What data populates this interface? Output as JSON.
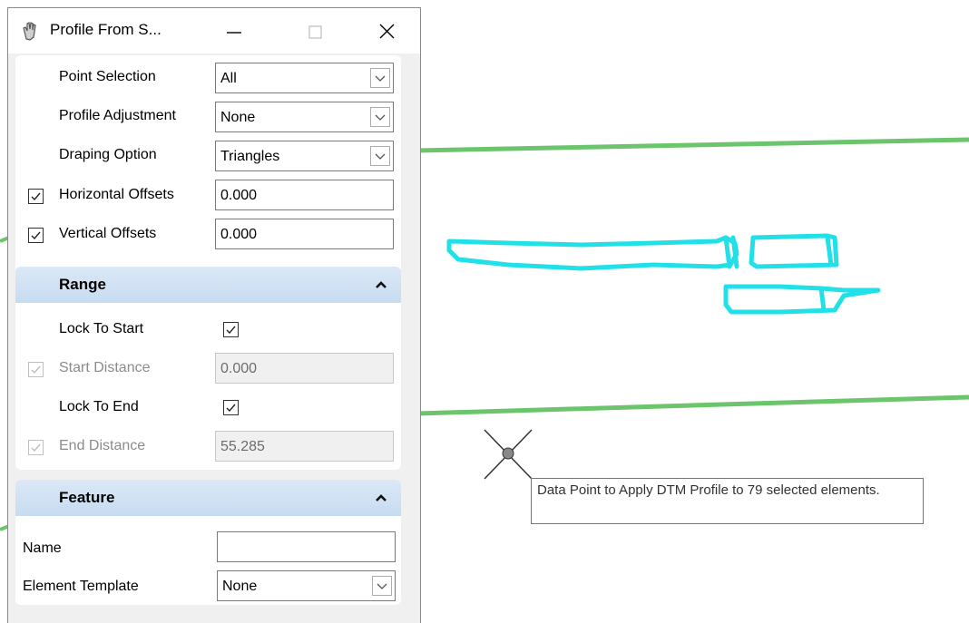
{
  "window": {
    "title": "Profile From S...",
    "minimize_icon": "minimize-icon",
    "maximize_icon": "maximize-icon",
    "close_icon": "close-icon",
    "app_icon": "hand-icon"
  },
  "settings": {
    "point_selection": {
      "label": "Point Selection",
      "value": "All"
    },
    "profile_adjustment": {
      "label": "Profile Adjustment",
      "value": "None"
    },
    "draping_option": {
      "label": "Draping Option",
      "value": "Triangles"
    },
    "horizontal_offsets": {
      "label": "Horizontal Offsets",
      "checked": true,
      "value": "0.000"
    },
    "vertical_offsets": {
      "label": "Vertical Offsets",
      "checked": true,
      "value": "0.000"
    }
  },
  "range": {
    "title": "Range",
    "lock_to_start": {
      "label": "Lock To Start",
      "checked": true
    },
    "start_distance": {
      "label": "Start Distance",
      "checked": true,
      "disabled": true,
      "value": "0.000"
    },
    "lock_to_end": {
      "label": "Lock To End",
      "checked": true
    },
    "end_distance": {
      "label": "End Distance",
      "checked": true,
      "disabled": true,
      "value": "55.285"
    }
  },
  "feature": {
    "title": "Feature",
    "name": {
      "label": "Name",
      "value": ""
    },
    "element_template": {
      "label": "Element Template",
      "value": "None"
    }
  },
  "canvas": {
    "tooltip": "Data Point to Apply DTM Profile to 79 selected elements.",
    "line_color": "#6cc56c",
    "sketch_color": "#22e0e8",
    "cursor_icon": "crosshair-cursor-icon"
  }
}
